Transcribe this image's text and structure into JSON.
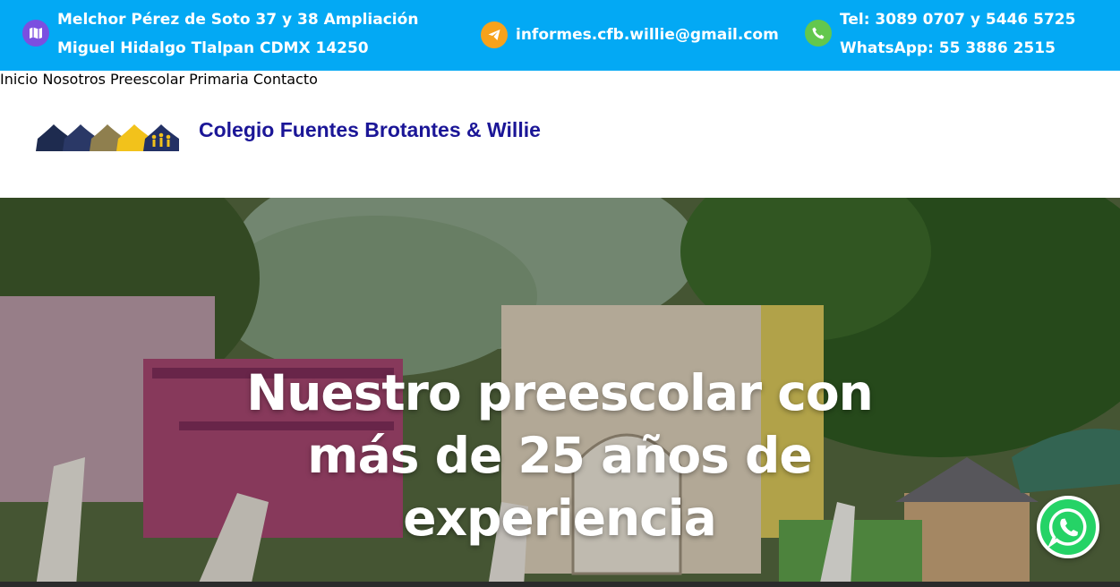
{
  "topbar": {
    "address_line1": "Melchor Pérez de Soto 37 y 38 Ampliación",
    "address_line2": "Miguel Hidalgo Tlalpan CDMX 14250",
    "email": "informes.cfb.willie@gmail.com",
    "phone_line1": "Tel: 3089 0707 y 5446 5725",
    "phone_line2": "WhatsApp: 55 3886 2515",
    "icons": [
      "map-icon",
      "send-icon",
      "phone-icon"
    ],
    "colors": {
      "bar": "#03A9F4",
      "map": "#7B4FE0",
      "send": "#F7A21B",
      "phone": "#63C74D"
    }
  },
  "header": {
    "brand": "Colegio Fuentes Brotantes & Willie",
    "brand_color": "#1B1697",
    "nav": [
      "Inicio",
      "Nosotros",
      "Preescolar",
      "Primaria",
      "Contacto"
    ]
  },
  "hero": {
    "title": "Nuestro preescolar con más de 25 años de experiencia"
  },
  "whatsapp": {
    "icon": "whatsapp-icon",
    "color": "#25D366"
  }
}
